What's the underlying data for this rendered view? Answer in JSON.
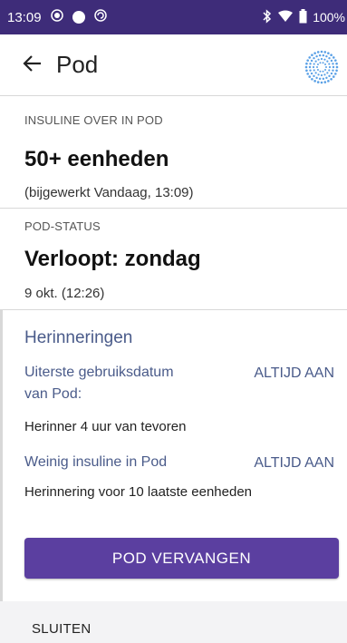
{
  "status_bar": {
    "time": "13:09",
    "battery": "100%",
    "icons": [
      "record-icon",
      "circle-icon",
      "sync-icon",
      "bluetooth-icon",
      "wifi-icon",
      "battery-icon"
    ]
  },
  "header": {
    "title": "Pod",
    "back_icon": "arrow-left-icon",
    "emblem_icon": "pod-dots-icon"
  },
  "insulin": {
    "label": "INSULINE OVER IN POD",
    "value": "50+ eenheden",
    "updated": "(bijgewerkt Vandaag, 13:09)"
  },
  "pod_status": {
    "label": "POD-STATUS",
    "value": "Verloopt: zondag",
    "date": "9 okt. (12:26)"
  },
  "reminders": {
    "heading": "Herinneringen",
    "items": [
      {
        "label_line1": "Uiterste gebruiksdatum",
        "label_line2": "van Pod:",
        "state": "ALTIJD AAN",
        "detail": "Herinner 4 uur van tevoren"
      },
      {
        "label_line1": "Weinig insuline in Pod",
        "label_line2": "",
        "state": "ALTIJD AAN",
        "detail": "Herinnering voor 10 laatste eenheden"
      }
    ]
  },
  "actions": {
    "replace_pod": "POD VERVANGEN",
    "close": "SLUITEN"
  },
  "colors": {
    "status_bar": "#3e2c79",
    "primary_button": "#5b3fa0",
    "accent_text": "#4a5b8a",
    "emblem": "#5aa0e6"
  }
}
